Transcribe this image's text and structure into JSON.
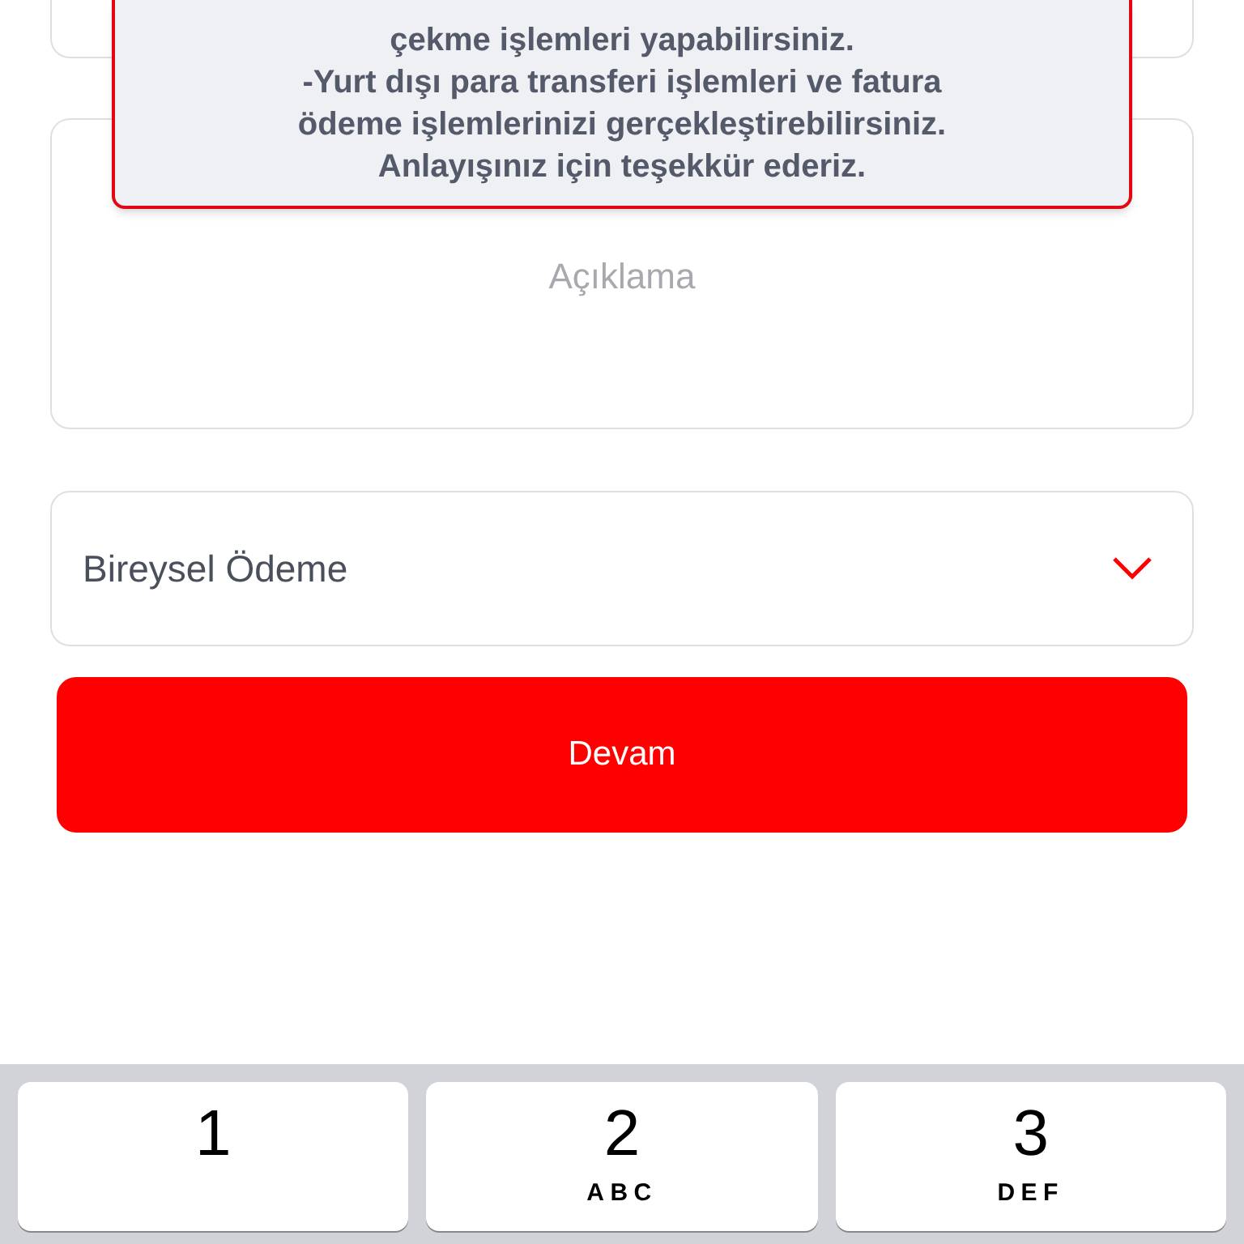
{
  "toast": {
    "lines": [
      "çekme işlemleri yapabilirsiniz.",
      "-Yurt dışı para transferi işlemleri ve fatura",
      "ödeme işlemlerinizi gerçekleştirebilirsiniz.",
      "Anlayışınız için teşekkür ederiz."
    ]
  },
  "description_field": {
    "placeholder": "Açıklama"
  },
  "payment_type": {
    "value": "Bireysel Ödeme"
  },
  "continue_button": {
    "label": "Devam"
  },
  "keypad": [
    {
      "digit": "1"
    },
    {
      "digit": "2",
      "letters": "ABC"
    },
    {
      "digit": "3",
      "letters": "DEF"
    }
  ]
}
